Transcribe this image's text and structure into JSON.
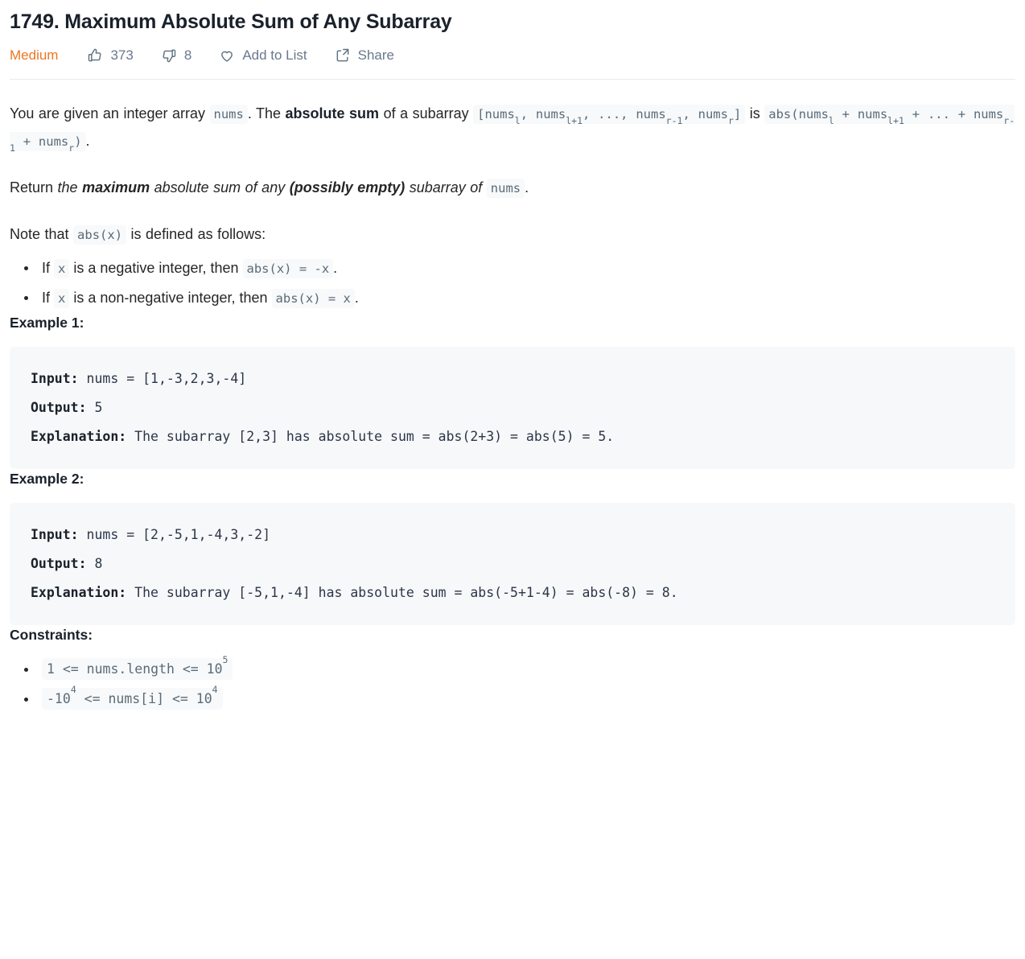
{
  "header": {
    "title": "1749. Maximum Absolute Sum of Any Subarray",
    "difficulty": "Medium",
    "likes": "373",
    "dislikes": "8",
    "add_to_list": "Add to List",
    "share": "Share",
    "icons": {
      "like": "thumbs-up-icon",
      "dislike": "thumbs-down-icon",
      "favorite": "heart-icon",
      "share": "share-icon"
    },
    "colors": {
      "difficulty": "#ef7521",
      "meta_text": "#68798c",
      "title": "#1a212b",
      "divider": "#eaeaea"
    }
  },
  "description": {
    "p1": {
      "t1": "You are given an integer array ",
      "c1": "nums",
      "t2": ". The ",
      "b1": "absolute sum",
      "t3": " of a subarray ",
      "c2_pre": "[nums",
      "c2_sub1": "l",
      "c2_mid1": ", nums",
      "c2_sub2": "l+1",
      "c2_mid2": ", ..., nums",
      "c2_sub3": "r-1",
      "c2_mid3": ", nums",
      "c2_sub4": "r",
      "c2_post": "]",
      "t4": " is ",
      "c3_pre": "abs(nums",
      "c3_sub1": "l",
      "c3_mid1": " + nums",
      "c3_sub2": "l+1",
      "c3_mid2": " + ... + nums",
      "c3_sub3": "r-1",
      "c3_mid3": " + nums",
      "c3_sub4": "r",
      "c3_post": ")",
      "t5": "."
    },
    "p2": {
      "t1": "Return ",
      "i1": "the ",
      "bi1": "maximum",
      "i2": " absolute sum of any ",
      "bi2": "(possibly empty)",
      "i3": " subarray of ",
      "c1": "nums",
      "t2": "."
    },
    "p3": {
      "t1": "Note that ",
      "c1": "abs(x)",
      "t2": " is defined as follows:"
    },
    "bullets": [
      {
        "t1": "If ",
        "c1": "x",
        "t2": " is a negative integer, then ",
        "c2": "abs(x) = -x",
        "t3": "."
      },
      {
        "t1": "If ",
        "c1": "x",
        "t2": " is a non-negative integer, then ",
        "c2": "abs(x) = x",
        "t3": "."
      }
    ]
  },
  "examples": [
    {
      "heading": "Example 1:",
      "input_label": "Input:",
      "input_value": " nums = [1,-3,2,3,-4]",
      "output_label": "Output:",
      "output_value": " 5",
      "explanation_label": "Explanation:",
      "explanation_value": " The subarray [2,3] has absolute sum = abs(2+3) = abs(5) = 5."
    },
    {
      "heading": "Example 2:",
      "input_label": "Input:",
      "input_value": " nums = [2,-5,1,-4,3,-2]",
      "output_label": "Output:",
      "output_value": " 8",
      "explanation_label": "Explanation:",
      "explanation_value": " The subarray [-5,1,-4] has absolute sum = abs(-5+1-4) = abs(-8) = 8."
    }
  ],
  "constraints": {
    "heading": "Constraints:",
    "items": [
      {
        "pre": "1 <= nums.length <= 10",
        "sup": "5",
        "post": ""
      },
      {
        "pre": "-10",
        "sup": "4",
        "post": " <= nums[i] <= 10",
        "sup2": "4"
      }
    ]
  }
}
